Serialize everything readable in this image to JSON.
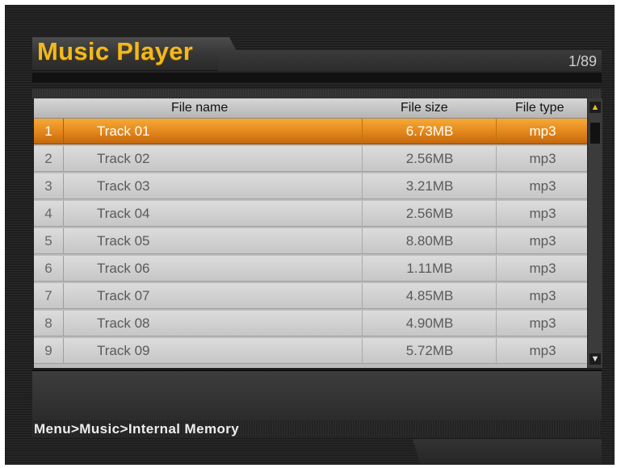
{
  "app": {
    "title": "Music Player",
    "page_counter": "1/89",
    "accent_color": "#f4b81c",
    "selection_color": "#e2861c"
  },
  "table": {
    "columns": {
      "name": "File name",
      "size": "File size",
      "type": "File type"
    },
    "selected_index": 0,
    "rows": [
      {
        "num": "1",
        "name": "Track 01",
        "size": "6.73MB",
        "type": "mp3"
      },
      {
        "num": "2",
        "name": "Track 02",
        "size": "2.56MB",
        "type": "mp3"
      },
      {
        "num": "3",
        "name": "Track 03",
        "size": "3.21MB",
        "type": "mp3"
      },
      {
        "num": "4",
        "name": "Track 04",
        "size": "2.56MB",
        "type": "mp3"
      },
      {
        "num": "5",
        "name": "Track 05",
        "size": "8.80MB",
        "type": "mp3"
      },
      {
        "num": "6",
        "name": "Track 06",
        "size": "1.11MB",
        "type": "mp3"
      },
      {
        "num": "7",
        "name": "Track 07",
        "size": "4.85MB",
        "type": "mp3"
      },
      {
        "num": "8",
        "name": "Track 08",
        "size": "4.90MB",
        "type": "mp3"
      },
      {
        "num": "9",
        "name": "Track 09",
        "size": "5.72MB",
        "type": "mp3"
      }
    ]
  },
  "scrollbar": {
    "up_icon": "chevron-up-icon",
    "down_icon": "chevron-down-icon"
  },
  "footer": {
    "breadcrumb": "Menu>Music>Internal Memory"
  }
}
